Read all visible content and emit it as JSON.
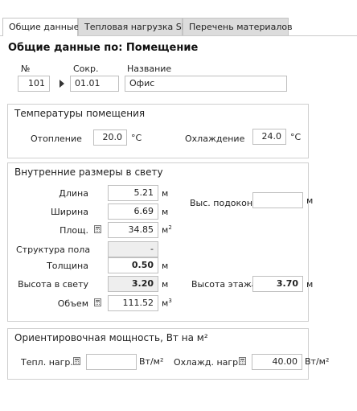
{
  "tabs": [
    {
      "label": "Общие данные"
    },
    {
      "label": "Тепловая нагрузка SP"
    },
    {
      "label": "Перечень материалов"
    }
  ],
  "header": {
    "title": "Общие данные по: Помещение"
  },
  "ident": {
    "num_label": "№",
    "num_value": "101",
    "abbr_label": "Сокр.",
    "abbr_value": "01.01",
    "name_label": "Название",
    "name_value": "Офис"
  },
  "temps": {
    "title": "Температуры помещения",
    "heating_label": "Отопление",
    "heating_value": "20.0",
    "heating_unit": "°C",
    "cooling_label": "Охлаждение",
    "cooling_value": "24.0",
    "cooling_unit": "°C"
  },
  "dims": {
    "title": "Внутренние размеры в свету",
    "length_label": "Длина",
    "length_value": "5.21",
    "length_unit": "м",
    "width_label": "Ширина",
    "width_value": "6.69",
    "width_unit": "м",
    "area_label": "Площ.",
    "area_value": "34.85",
    "area_unit": "м",
    "floor_label": "Структура пола",
    "floor_value": "-",
    "thickness_label": "Толщина",
    "thickness_value": "0.50",
    "thickness_unit": "м",
    "clear_height_label": "Высота в свету",
    "clear_height_value": "3.20",
    "clear_height_unit": "м",
    "volume_label": "Объем",
    "volume_value": "111.52",
    "volume_unit": "м",
    "sill_label": "Выс. подокон.",
    "sill_value": "",
    "sill_unit": "м",
    "floor_height_label": "Высота этажа",
    "floor_height_value": "3.70",
    "floor_height_unit": "м"
  },
  "power": {
    "title": "Ориентировочная мощность, Вт на м²",
    "heat_label": "Тепл. нагр.",
    "heat_value": "",
    "heat_unit": "Вт/м²",
    "cool_label": "Охлажд. нагр.",
    "cool_value": "40.00",
    "cool_unit": "Вт/м²"
  },
  "icons": {
    "calculator": "calculator-icon",
    "arrow": "arrow-right-icon"
  }
}
